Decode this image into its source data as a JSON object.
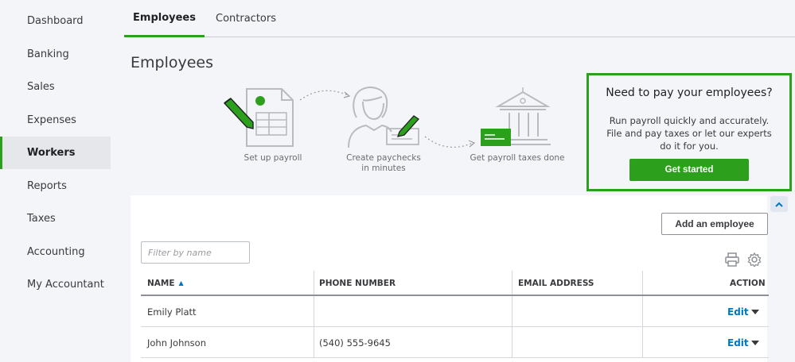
{
  "sidebar": {
    "items": [
      {
        "label": "Dashboard"
      },
      {
        "label": "Banking"
      },
      {
        "label": "Sales"
      },
      {
        "label": "Expenses"
      },
      {
        "label": "Workers"
      },
      {
        "label": "Reports"
      },
      {
        "label": "Taxes"
      },
      {
        "label": "Accounting"
      },
      {
        "label": "My Accountant"
      }
    ],
    "active": "Workers"
  },
  "tabs": [
    {
      "label": "Employees"
    },
    {
      "label": "Contractors"
    }
  ],
  "page_title": "Employees",
  "steps": [
    {
      "label": "Set up payroll"
    },
    {
      "label_line1": "Create paychecks",
      "label_line2": "in minutes"
    },
    {
      "label": "Get payroll taxes done"
    }
  ],
  "promo": {
    "title": "Need to pay your employees?",
    "line1": "Run payroll quickly and accurately.",
    "line2": "File and pay taxes or let our experts",
    "line3": "do it for you.",
    "button": "Get started"
  },
  "add_employee": "Add an employee",
  "filter": {
    "placeholder": "Filter by name"
  },
  "table": {
    "columns": [
      "NAME",
      "PHONE NUMBER",
      "EMAIL ADDRESS",
      "ACTION"
    ],
    "sort_indicator": "▲",
    "rows": [
      {
        "name": "Emily Platt",
        "phone": "",
        "email": "",
        "action": "Edit"
      },
      {
        "name": "John Johnson",
        "phone": "(540) 555-9645",
        "email": "",
        "action": "Edit"
      }
    ]
  },
  "colors": {
    "accent": "#2ca01c",
    "link": "#0077c5"
  }
}
